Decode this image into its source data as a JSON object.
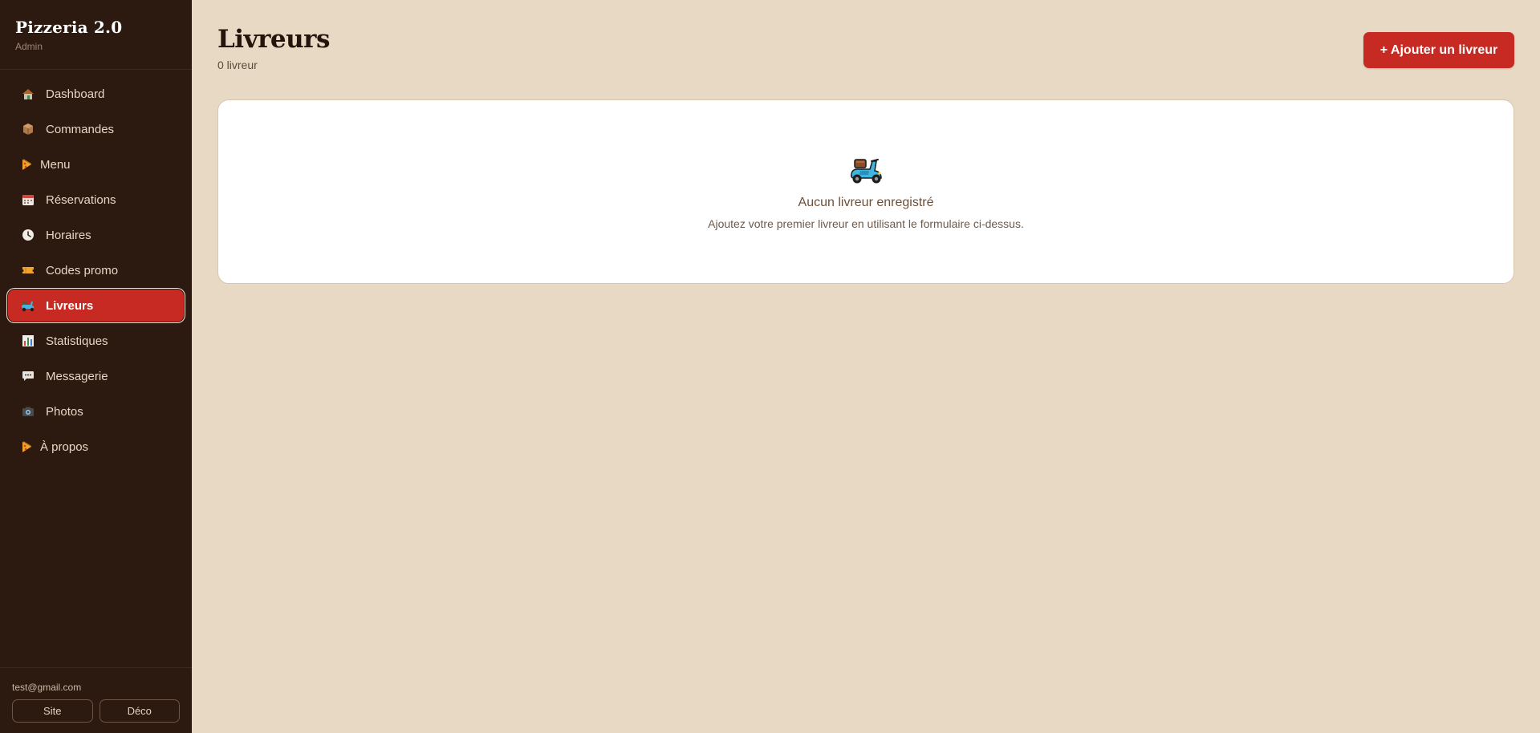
{
  "brand": {
    "title": "Pizzeria 2.0",
    "subtitle": "Admin"
  },
  "nav": {
    "items": [
      {
        "label": "Dashboard",
        "icon": "house-icon"
      },
      {
        "label": "Commandes",
        "icon": "package-icon"
      },
      {
        "label": "Menu",
        "icon": "pizza-icon"
      },
      {
        "label": "Réservations",
        "icon": "calendar-icon"
      },
      {
        "label": "Horaires",
        "icon": "clock-icon"
      },
      {
        "label": "Codes promo",
        "icon": "ticket-icon"
      },
      {
        "label": "Livreurs",
        "icon": "scooter-icon",
        "active": true
      },
      {
        "label": "Statistiques",
        "icon": "bar-chart-icon"
      },
      {
        "label": "Messagerie",
        "icon": "speech-bubble-icon"
      },
      {
        "label": "Photos",
        "icon": "camera-icon"
      },
      {
        "label": "À propos",
        "icon": "pizza-icon"
      }
    ]
  },
  "footer": {
    "email": "test@gmail.com",
    "site_label": "Site",
    "logout_label": "Déco"
  },
  "header": {
    "title": "Livreurs",
    "count": "0 livreur",
    "add_button": "+ Ajouter un livreur"
  },
  "empty_state": {
    "icon": "scooter-icon",
    "title": "Aucun livreur enregistré",
    "description": "Ajoutez votre premier livreur en utilisant le formulaire ci-dessus."
  },
  "colors": {
    "sidebar_bg": "#2c1a10",
    "page_bg": "#e7d9c4",
    "accent": "#c62a22",
    "card_bg": "#ffffff"
  }
}
